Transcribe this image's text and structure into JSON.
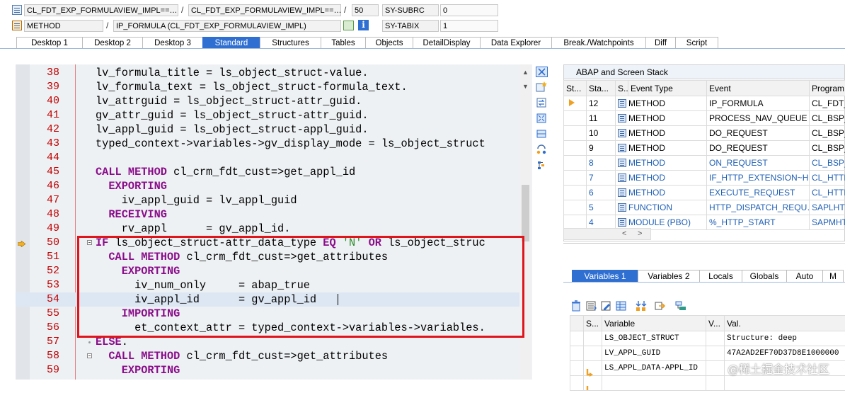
{
  "header": {
    "row1": {
      "program": "CL_FDT_EXP_FORMULAVIEW_IMPL==…",
      "include": "CL_FDT_EXP_FORMULAVIEW_IMPL==…",
      "line": "50",
      "sysfield1": "SY-SUBRC",
      "sysvalue1": "0"
    },
    "row2": {
      "type": "METHOD",
      "method": "IP_FORMULA (CL_FDT_EXP_FORMULAVIEW_IMPL)",
      "sysfield2": "SY-TABIX",
      "sysvalue2": "1"
    },
    "separator": "/"
  },
  "tabs": [
    "Desktop 1",
    "Desktop 2",
    "Desktop 3",
    "Standard",
    "Structures",
    "Tables",
    "Objects",
    "DetailDisplay",
    "Data Explorer",
    "Break./Watchpoints",
    "Diff",
    "Script"
  ],
  "active_tab": "Standard",
  "code_lines": [
    {
      "num": "38",
      "text": "lv_formula_title = ls_object_struct-value."
    },
    {
      "num": "39",
      "text": "lv_formula_text = ls_object_struct-formula_text."
    },
    {
      "num": "40",
      "text": "lv_attrguid = ls_object_struct-attr_guid."
    },
    {
      "num": "41",
      "text": "gv_attr_guid = ls_object_struct-attr_guid."
    },
    {
      "num": "42",
      "text": "lv_appl_guid = ls_object_struct-appl_guid."
    },
    {
      "num": "43",
      "text": "typed_context->variables->gv_display_mode = ls_object_struct"
    },
    {
      "num": "44",
      "text": ""
    },
    {
      "num": "45",
      "kw": "CALL METHOD",
      "text": " cl_crm_fdt_cust=>get_appl_id"
    },
    {
      "num": "46",
      "kw": "  EXPORTING",
      "text": ""
    },
    {
      "num": "47",
      "text": "    iv_appl_guid = lv_appl_guid"
    },
    {
      "num": "48",
      "kw": "  RECEIVING",
      "text": ""
    },
    {
      "num": "49",
      "text": "    rv_appl      = gv_appl_id."
    },
    {
      "num": "50",
      "kw": "IF",
      "text": " ls_object_struct-attr_data_type ",
      "kw2": "EQ",
      "str": " 'N' ",
      "kw3": "OR",
      "text2": " ls_object_struc"
    },
    {
      "num": "51",
      "kw": "  CALL METHOD",
      "text": " cl_crm_fdt_cust=>get_attributes"
    },
    {
      "num": "52",
      "kw": "    EXPORTING",
      "text": ""
    },
    {
      "num": "53",
      "text": "      iv_num_only     = abap_true"
    },
    {
      "num": "54",
      "text": "      iv_appl_id      = gv_appl_id"
    },
    {
      "num": "55",
      "kw": "    IMPORTING",
      "text": ""
    },
    {
      "num": "56",
      "text": "      et_context_attr = typed_context->variables->variables."
    },
    {
      "num": "57",
      "kw": "ELSE",
      "text": "."
    },
    {
      "num": "58",
      "kw": "  CALL METHOD",
      "text": " cl_crm_fdt_cust=>get_attributes"
    },
    {
      "num": "59",
      "kw": "    EXPORTING",
      "text": ""
    }
  ],
  "stack": {
    "title": "ABAP and Screen Stack",
    "columns": [
      "St...",
      "Sta...",
      "S...",
      "Event Type",
      "Event",
      "Program"
    ],
    "rows": [
      {
        "level": "12",
        "type": "METHOD",
        "event": "IP_FORMULA",
        "program": "CL_FDT_",
        "current": true,
        "blue": false
      },
      {
        "level": "11",
        "type": "METHOD",
        "event": "PROCESS_NAV_QUEUE",
        "program": "CL_BSP_",
        "current": false,
        "blue": false
      },
      {
        "level": "10",
        "type": "METHOD",
        "event": "DO_REQUEST",
        "program": "CL_BSP_",
        "current": false,
        "blue": false
      },
      {
        "level": "9",
        "type": "METHOD",
        "event": "DO_REQUEST",
        "program": "CL_BSP_",
        "current": false,
        "blue": false
      },
      {
        "level": "8",
        "type": "METHOD",
        "event": "ON_REQUEST",
        "program": "CL_BSP_",
        "current": false,
        "blue": true
      },
      {
        "level": "7",
        "type": "METHOD",
        "event": "IF_HTTP_EXTENSION~H…",
        "program": "CL_HTTP",
        "current": false,
        "blue": true
      },
      {
        "level": "6",
        "type": "METHOD",
        "event": "EXECUTE_REQUEST",
        "program": "CL_HTTP",
        "current": false,
        "blue": true
      },
      {
        "level": "5",
        "type": "FUNCTION",
        "event": "HTTP_DISPATCH_REQU…",
        "program": "SAPLHTT",
        "current": false,
        "blue": true
      },
      {
        "level": "4",
        "type": "MODULE (PBO)",
        "event": "%_HTTP_START",
        "program": "SAPMHTT",
        "current": false,
        "blue": true
      }
    ]
  },
  "var_tabs": [
    "Variables 1",
    "Variables 2",
    "Locals",
    "Globals",
    "Auto",
    "M"
  ],
  "active_var_tab": "Variables 1",
  "variables": {
    "columns": [
      "S...",
      "Variable",
      "V...",
      "Val."
    ],
    "rows": [
      {
        "name": "LS_OBJECT_STRUCT",
        "value": "Structure: deep",
        "changed": false
      },
      {
        "name": "LV_APPL_GUID",
        "value": "47A2AD2EF70D37D8E1000000",
        "changed": false
      },
      {
        "name": "LS_APPL_DATA-APPL_ID",
        "value": "",
        "changed": true
      },
      {
        "name": "",
        "value": "",
        "changed": true
      }
    ]
  },
  "watermark": "@稀土掘金技术社区",
  "colors": {
    "accent": "#2f6fd1",
    "highlight_box": "#e0141b",
    "keyword": "#8a0d8a",
    "line_number": "#c00000"
  }
}
